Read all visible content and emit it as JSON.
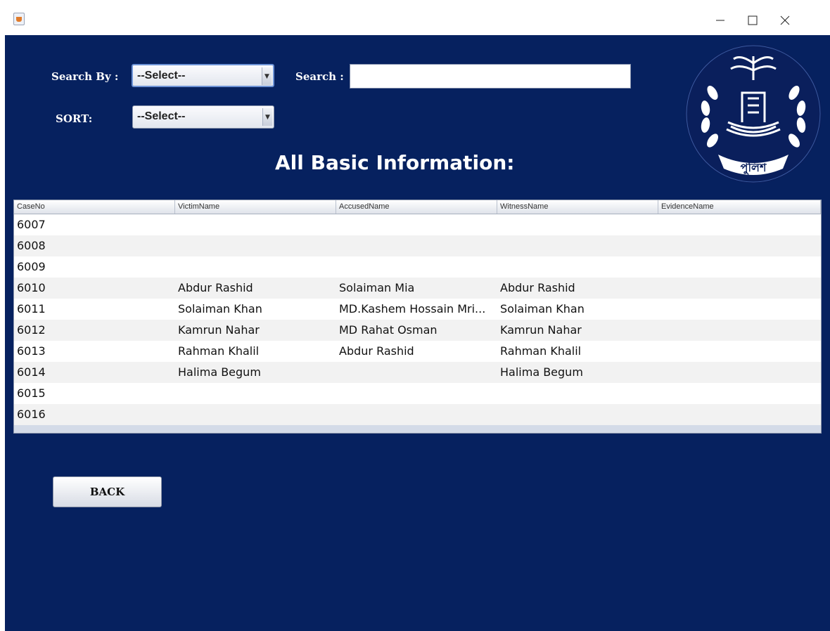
{
  "window": {
    "icon": "java-cup-icon",
    "controls": {
      "minimize": "minimize-icon",
      "maximize": "maximize-icon",
      "close": "close-icon"
    }
  },
  "filters": {
    "search_by_label": "Search By :",
    "search_by_value": "--Select--",
    "search_label": "Search :",
    "search_value": "",
    "sort_label": "SORT:",
    "sort_value": "--Select--"
  },
  "heading": "All Basic Information:",
  "logo": {
    "icon": "police-emblem-logo",
    "text": "পুলিশ"
  },
  "table": {
    "columns": [
      "CaseNo",
      "VictimName",
      "AccusedName",
      "WitnessName",
      "EvidenceName"
    ],
    "rows": [
      [
        "6007",
        "",
        "",
        "",
        ""
      ],
      [
        "6008",
        "",
        "",
        "",
        ""
      ],
      [
        "6009",
        "",
        "",
        "",
        ""
      ],
      [
        "6010",
        "Abdur Rashid",
        "Solaiman Mia",
        "Abdur Rashid",
        ""
      ],
      [
        "6011",
        "Solaiman Khan",
        "MD.Kashem Hossain Mri...",
        "Solaiman Khan",
        ""
      ],
      [
        "6012",
        "Kamrun Nahar",
        "MD Rahat Osman",
        "Kamrun Nahar",
        ""
      ],
      [
        "6013",
        "Rahman Khalil",
        "Abdur Rashid",
        "Rahman Khalil",
        ""
      ],
      [
        "6014",
        "Halima Begum",
        "",
        "Halima Begum",
        ""
      ],
      [
        "6015",
        "",
        "",
        "",
        ""
      ],
      [
        "6016",
        "",
        "",
        "",
        ""
      ]
    ]
  },
  "back_button": "BACK",
  "colors": {
    "background": "#06215f",
    "heading_text": "#ffffff",
    "logo_bg": "#0a1f5c"
  }
}
